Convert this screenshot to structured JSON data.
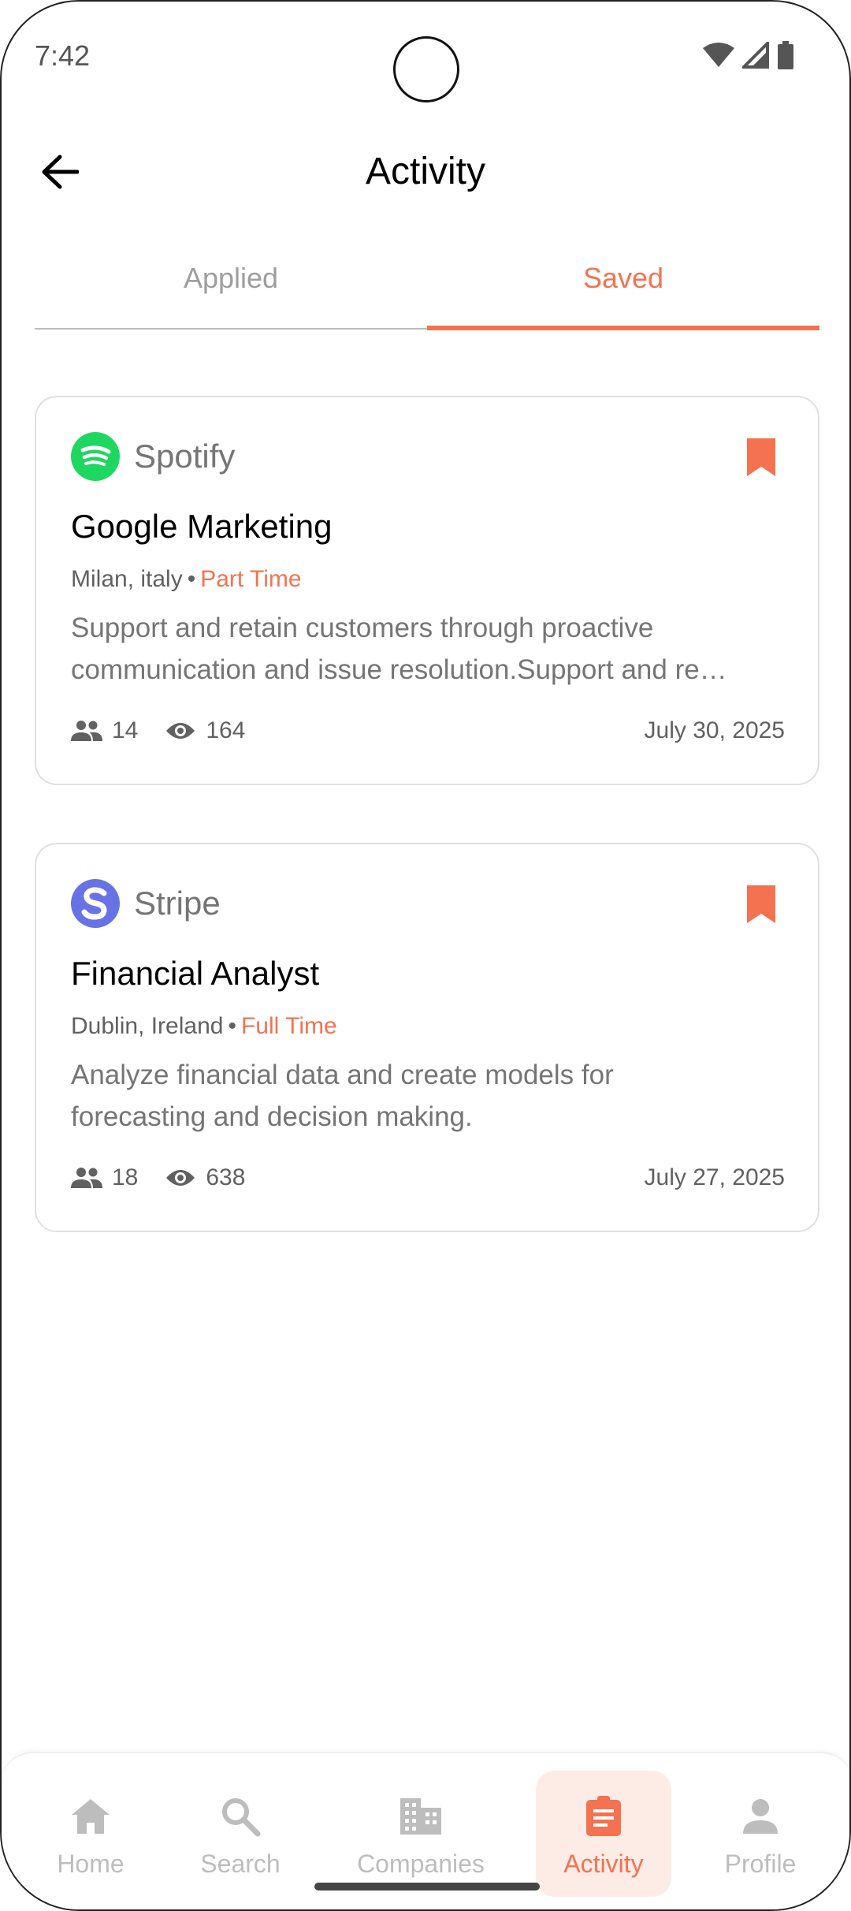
{
  "status": {
    "time": "7:42"
  },
  "header": {
    "title": "Activity"
  },
  "tabs": [
    {
      "label": "Applied",
      "active": false
    },
    {
      "label": "Saved",
      "active": true
    }
  ],
  "jobs": [
    {
      "company": "Spotify",
      "title": "Google Marketing",
      "location": "Milan, italy",
      "separator": "•",
      "type": "Part Time",
      "description_lines": [
        "Support and retain customers through proactive",
        "communication and issue resolution.Support and re…"
      ],
      "applicants": "14",
      "views": "164",
      "date": "July 30, 2025"
    },
    {
      "company": "Stripe",
      "title": "Financial Analyst",
      "location": "Dublin, Ireland",
      "separator": "•",
      "type": "Full Time",
      "description_lines": [
        "Analyze financial data and create models for",
        "forecasting and decision making."
      ],
      "applicants": "18",
      "views": "638",
      "date": "July 27, 2025"
    }
  ],
  "nav": [
    {
      "label": "Home",
      "icon": "home-icon",
      "active": false
    },
    {
      "label": "Search",
      "icon": "search-icon",
      "active": false
    },
    {
      "label": "Companies",
      "icon": "building-icon",
      "active": false
    },
    {
      "label": "Activity",
      "icon": "clipboard-icon",
      "active": true
    },
    {
      "label": "Profile",
      "icon": "person-icon",
      "active": false
    }
  ],
  "colors": {
    "accent": "#f47250",
    "accent_bg": "#fdece6",
    "spotify": "#1ed760",
    "stripe": "#6772e5",
    "muted_text": "#757575",
    "inactive_nav": "#bdbdbd"
  }
}
